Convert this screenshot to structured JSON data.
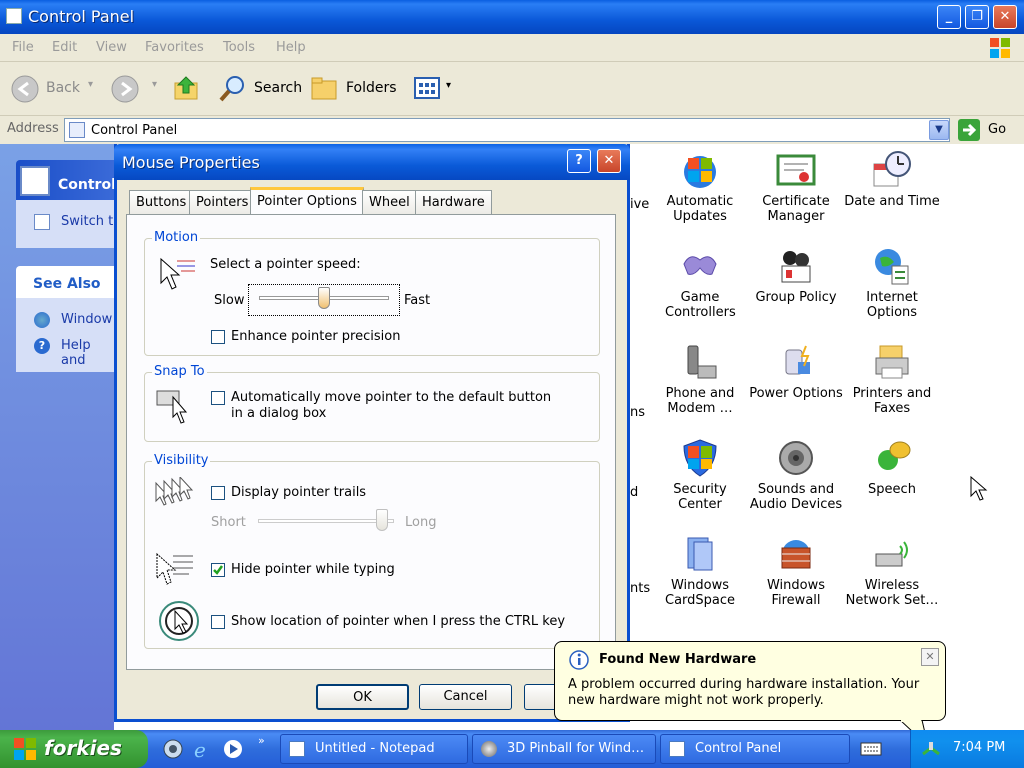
{
  "window": {
    "title": "Control Panel"
  },
  "menu": [
    "File",
    "Edit",
    "View",
    "Favorites",
    "Tools",
    "Help"
  ],
  "toolbar": {
    "back": "Back",
    "search": "Search",
    "folders": "Folders"
  },
  "address": {
    "label": "Address",
    "value": "Control Panel",
    "go": "Go"
  },
  "sidebar": {
    "control_title": "Control",
    "switch": "Switch t",
    "see_also": "See Also",
    "links": [
      "Window",
      "Help and"
    ]
  },
  "partial_labels": [
    "ive",
    "ns",
    "d",
    "nts"
  ],
  "icons": [
    {
      "label": "Automatic Updates"
    },
    {
      "label": "Certificate Manager"
    },
    {
      "label": "Date and Time"
    },
    {
      "label": "Game Controllers"
    },
    {
      "label": "Group Policy"
    },
    {
      "label": "Internet Options"
    },
    {
      "label": "Phone and Modem …"
    },
    {
      "label": "Power Options"
    },
    {
      "label": "Printers and Faxes"
    },
    {
      "label": "Security Center"
    },
    {
      "label": "Sounds and Audio Devices"
    },
    {
      "label": "Speech"
    },
    {
      "label": "Windows CardSpace"
    },
    {
      "label": "Windows Firewall"
    },
    {
      "label": "Wireless Network Set…"
    }
  ],
  "dialog": {
    "title": "Mouse Properties",
    "tabs": [
      "Buttons",
      "Pointers",
      "Pointer Options",
      "Wheel",
      "Hardware"
    ],
    "motion": {
      "group": "Motion",
      "speed_label": "Select a pointer speed:",
      "slow": "Slow",
      "fast": "Fast",
      "speed_level": 0.5,
      "enhance": "Enhance pointer precision",
      "enhance_checked": false
    },
    "snap": {
      "group": "Snap To",
      "label": "Automatically move pointer to the default button in a dialog box",
      "checked": false
    },
    "visibility": {
      "group": "Visibility",
      "trails": "Display pointer trails",
      "trails_checked": false,
      "short": "Short",
      "long": "Long",
      "trail_level": 1.0,
      "hide": "Hide pointer while typing",
      "hide_checked": true,
      "show": "Show location of pointer when I press the CTRL key",
      "show_checked": false
    },
    "buttons": {
      "ok": "OK",
      "cancel": "Cancel"
    }
  },
  "balloon": {
    "title": "Found New Hardware",
    "text": "A problem occurred during hardware installation. Your new hardware might not work properly."
  },
  "taskbar": {
    "start": "forkies",
    "tasks": [
      "Untitled - Notepad",
      "3D Pinball for Wind…",
      "Control Panel"
    ],
    "time": "7:04 PM"
  },
  "colors": {
    "title_blue": "#0a58d8",
    "taskbar_blue": "#245dd7",
    "start_green": "#3c9a3c",
    "balloon_bg": "#ffffe1",
    "group_label": "#0046d5"
  }
}
